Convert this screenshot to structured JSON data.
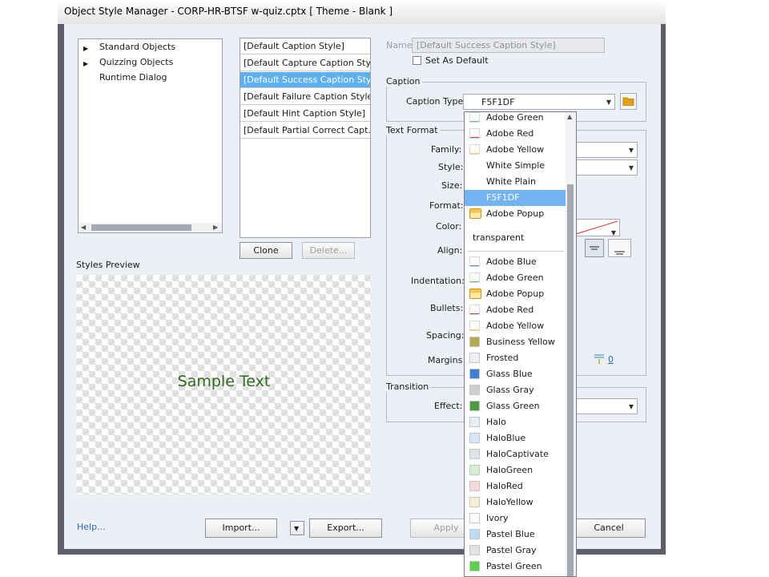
{
  "window": {
    "title": "Object Style Manager - CORP-HR-BTSF w-quiz.cptx [ Theme - Blank ]"
  },
  "tree": {
    "items": [
      {
        "label": "Standard Objects",
        "expandable": true
      },
      {
        "label": "Quizzing Objects",
        "expandable": true
      },
      {
        "label": "Runtime Dialog",
        "expandable": false
      }
    ]
  },
  "styles_list": {
    "items": [
      "[Default Caption Style]",
      "[Default Capture Caption Sty...",
      "[Default Success Caption Sty...",
      "[Default Failure Caption Style]",
      "[Default Hint Caption Style]",
      "[Default Partial Correct Capt..."
    ],
    "selected_index": 2,
    "clone_label": "Clone",
    "delete_label": "Delete..."
  },
  "preview": {
    "title": "Styles Preview",
    "sample_text": "Sample Text"
  },
  "name_field": {
    "label": "Name",
    "value": "[Default Success Caption Style]"
  },
  "set_default": {
    "label": "Set As Default"
  },
  "caption": {
    "group_title": "Caption",
    "type_label": "Caption Type",
    "type_value": "F5F1DF"
  },
  "text_format": {
    "group_title": "Text Format",
    "labels": {
      "family": "Family:",
      "style": "Style:",
      "size": "Size:",
      "format": "Format:",
      "color": "Color:",
      "align": "Align:",
      "indentation": "Indentation:",
      "bullets": "Bullets:",
      "spacing": "Spacing:",
      "margins": "Margins"
    },
    "margin_value": "0"
  },
  "transition": {
    "group_title": "Transition",
    "effect_label": "Effect:"
  },
  "dropdown": {
    "items": [
      {
        "label": "Adobe Green",
        "swatch": "line",
        "color": "#6cc26c"
      },
      {
        "label": "Adobe Red",
        "swatch": "line",
        "color": "#d63b3b"
      },
      {
        "label": "Adobe Yellow",
        "swatch": "line",
        "color": "#e8cf5a"
      },
      {
        "label": "White Simple",
        "swatch": "none",
        "color": ""
      },
      {
        "label": "White Plain",
        "swatch": "none",
        "color": ""
      },
      {
        "label": "F5F1DF",
        "swatch": "none",
        "color": "",
        "selected": true
      },
      {
        "label": "Adobe Popup",
        "swatch": "popup",
        "color": "#f5c64a"
      },
      {
        "label": "transparent",
        "swatch": "none",
        "color": "",
        "separator": true
      },
      {
        "label": "Adobe Blue",
        "swatch": "line",
        "color": "#4a8fd8"
      },
      {
        "label": "Adobe Green",
        "swatch": "line",
        "color": "#6cc26c"
      },
      {
        "label": "Adobe Popup",
        "swatch": "popup",
        "color": "#f5c64a"
      },
      {
        "label": "Adobe Red",
        "swatch": "line",
        "color": "#d63b3b"
      },
      {
        "label": "Adobe Yellow",
        "swatch": "line",
        "color": "#e8cf5a"
      },
      {
        "label": "Business Yellow",
        "swatch": "fill",
        "color": "#b5a850"
      },
      {
        "label": "Frosted",
        "swatch": "fill",
        "color": "#eef0f6"
      },
      {
        "label": "Glass Blue",
        "swatch": "fill",
        "color": "#3e7fd1"
      },
      {
        "label": "Glass Gray",
        "swatch": "fill",
        "color": "#cfcfcf"
      },
      {
        "label": "Glass Green",
        "swatch": "fill",
        "color": "#4e9b3f"
      },
      {
        "label": "Halo",
        "swatch": "fill",
        "color": "#e9eef0"
      },
      {
        "label": "HaloBlue",
        "swatch": "fill",
        "color": "#d6e7f7"
      },
      {
        "label": "HaloCaptivate",
        "swatch": "fill",
        "color": "#dbe4e8"
      },
      {
        "label": "HaloGreen",
        "swatch": "fill",
        "color": "#d4efcf"
      },
      {
        "label": "HaloRed",
        "swatch": "fill",
        "color": "#f7d8d8"
      },
      {
        "label": "HaloYellow",
        "swatch": "fill",
        "color": "#faeed0"
      },
      {
        "label": "Ivory",
        "swatch": "fill",
        "color": "#ffffff"
      },
      {
        "label": "Pastel Blue",
        "swatch": "fill",
        "color": "#bcdcf4"
      },
      {
        "label": "Pastel Gray",
        "swatch": "fill",
        "color": "#e2e2e2"
      },
      {
        "label": "Pastel Green",
        "swatch": "fill",
        "color": "#5ad04a"
      }
    ]
  },
  "footer": {
    "help_label": "Help...",
    "import_label": "Import...",
    "export_label": "Export...",
    "apply_label": "Apply",
    "cancel_label": "Cancel"
  },
  "colors": {
    "selection": "#5fb0f1",
    "help_link": "#2b6cb0",
    "sample_text": "#2c6b1c",
    "folder": "#e0a313"
  }
}
